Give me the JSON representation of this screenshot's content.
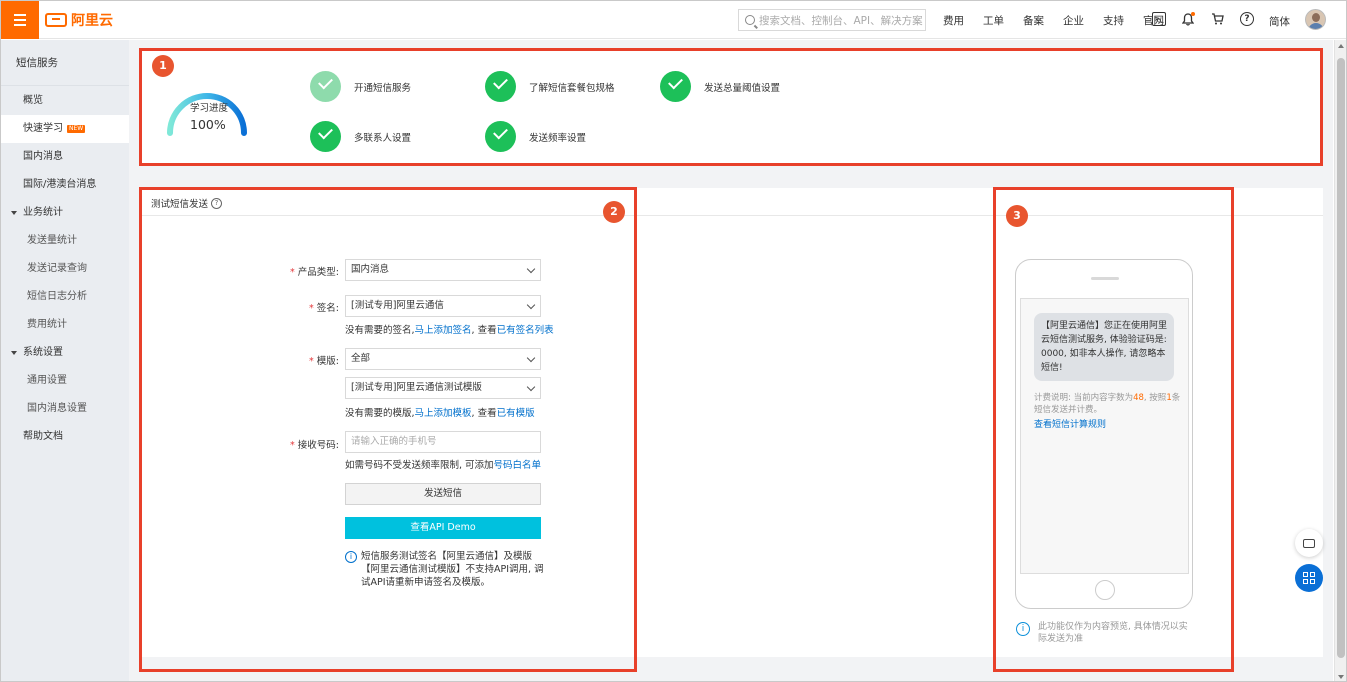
{
  "topbar": {
    "logo_text": "阿里云",
    "search_placeholder": "搜索文档、控制台、API、解决方案",
    "nav": [
      "费用",
      "工单",
      "备案",
      "企业",
      "支持",
      "官网"
    ],
    "terminal_label": ">_",
    "lang": "简体",
    "icons": [
      "menu-icon",
      "search-icon",
      "terminal-icon",
      "bell-icon",
      "cart-icon",
      "help-icon",
      "avatar"
    ]
  },
  "sidebar": {
    "title": "短信服务",
    "items": [
      {
        "label": "概览"
      },
      {
        "label": "快速学习",
        "badge": "NEW"
      },
      {
        "label": "国内消息"
      },
      {
        "label": "国际/港澳台消息"
      }
    ],
    "group1": {
      "label": "业务统计",
      "items": [
        "发送量统计",
        "发送记录查询",
        "短信日志分析",
        "费用统计"
      ]
    },
    "group2": {
      "label": "系统设置",
      "items": [
        "通用设置",
        "国内消息设置"
      ]
    },
    "help": "帮助文档"
  },
  "progress": {
    "label": "学习进度",
    "value": "100%",
    "fraction": 1.0,
    "tasks": [
      "开通短信服务",
      "了解短信套餐包规格",
      "发送总量阈值设置",
      "多联系人设置",
      "发送频率设置"
    ]
  },
  "send_form": {
    "title": "测试短信发送",
    "product_label": "产品类型:",
    "product_value": "国内消息",
    "sign_label": "签名:",
    "sign_value": "[测试专用]阿里云通信",
    "sign_hint_prefix": "没有需要的签名,",
    "sign_hint_link1": "马上添加签名",
    "sign_hint_mid": ", 查看",
    "sign_hint_link2": "已有签名列表",
    "template_label": "模版:",
    "template_filter": "全部",
    "template_value": "[测试专用]阿里云通信测试模版",
    "template_hint_prefix": "没有需要的模版,",
    "template_hint_link1": "马上添加模板",
    "template_hint_mid": ", 查看",
    "template_hint_link2": "已有模版",
    "phone_label": "接收号码:",
    "phone_placeholder": "请输入正确的手机号",
    "phone_hint_prefix": "如需号码不受发送频率限制, 可添加",
    "phone_hint_link": "号码白名单",
    "send_button": "发送短信",
    "demo_button": "查看API Demo",
    "note": "短信服务测试签名【阿里云通信】及模版【阿里云通信测试模版】不支持API调用, 调试API请重新申请签名及模版。"
  },
  "preview": {
    "message": "【阿里云通信】您正在使用阿里云短信测试服务, 体验验证码是: 0000, 如非本人操作, 请忽略本短信!",
    "billing_prefix": "计费说明: 当前内容字数为",
    "billing_count": "48",
    "billing_mid": ", 按照",
    "billing_sms": "1",
    "billing_suffix": "条短信发送并计费。",
    "billing_link": "查看短信计算规则",
    "disclaimer": "此功能仅作为内容预览, 具体情况以实际发送为准"
  },
  "annotations": [
    "1",
    "2",
    "3"
  ],
  "colors": {
    "brand": "#ff6a00",
    "success": "#1dc059",
    "link": "#0070cc",
    "primary": "#00c1de",
    "annotation": "#e8402a"
  }
}
